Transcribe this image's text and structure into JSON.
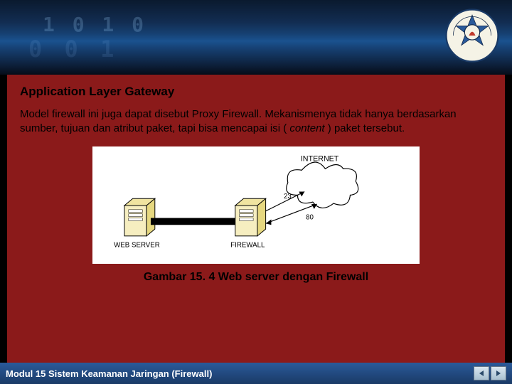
{
  "header": {
    "decorative_bits_1": "1 0 1 0",
    "decorative_bits_2": "0 0 1"
  },
  "slide": {
    "title": "Application Layer Gateway",
    "body_pre": "Model firewall ini juga dapat disebut Proxy Firewall. Mekanismenya tidak hanya berdasarkan sumber, tujuan dan atribut paket, tapi bisa mencapai isi ( ",
    "body_italic": "content",
    "body_post": " ) paket tersebut.",
    "caption": "Gambar 15. 4 Web server dengan Firewall"
  },
  "diagram": {
    "label_internet": "INTERNET",
    "label_webserver": "WEB SERVER",
    "label_firewall": "FIREWALL",
    "port_23": "23",
    "port_80": "80"
  },
  "footer": {
    "title": "Modul 15 Sistem Keamanan Jaringan (Firewall)"
  }
}
